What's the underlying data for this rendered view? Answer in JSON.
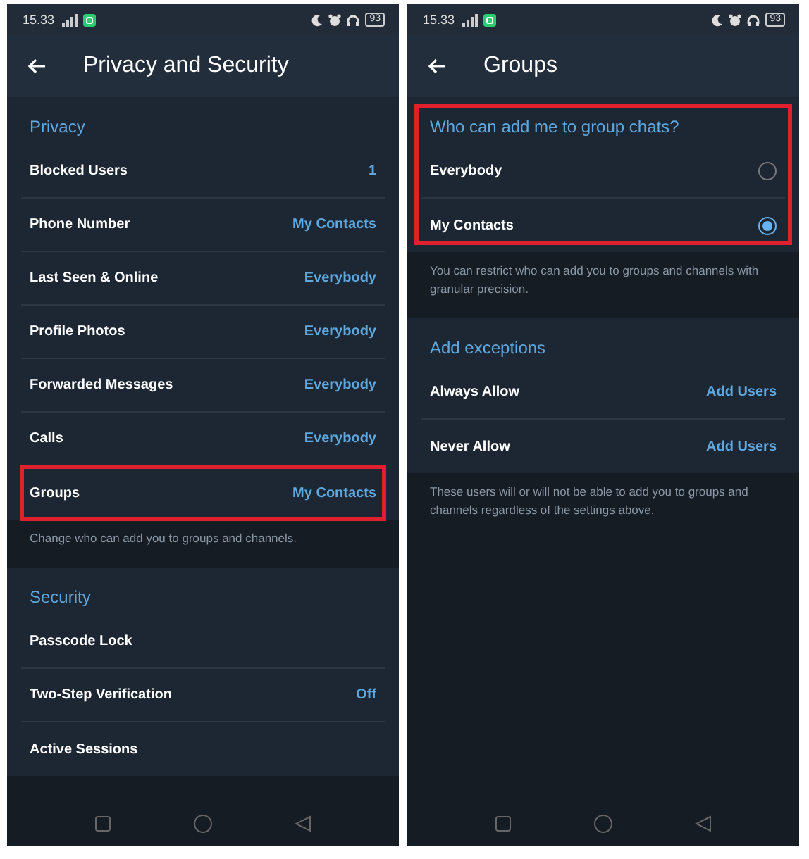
{
  "screens": [
    {
      "status_bar": {
        "time": "15.33",
        "battery": "93"
      },
      "title": "Privacy and Security",
      "sections": [
        {
          "title": "Privacy",
          "highlighted": false,
          "rows": [
            {
              "kind": "value",
              "label": "Blocked Users",
              "value": "1",
              "highlighted": false
            },
            {
              "kind": "value",
              "label": "Phone Number",
              "value": "My Contacts",
              "highlighted": false
            },
            {
              "kind": "value",
              "label": "Last Seen & Online",
              "value": "Everybody",
              "highlighted": false
            },
            {
              "kind": "value",
              "label": "Profile Photos",
              "value": "Everybody",
              "highlighted": false
            },
            {
              "kind": "value",
              "label": "Forwarded Messages",
              "value": "Everybody",
              "highlighted": false
            },
            {
              "kind": "value",
              "label": "Calls",
              "value": "Everybody",
              "highlighted": false
            },
            {
              "kind": "value",
              "label": "Groups",
              "value": "My Contacts",
              "highlighted": true
            }
          ],
          "footer": "Change who can add you to groups and channels."
        },
        {
          "title": "Security",
          "highlighted": false,
          "rows": [
            {
              "kind": "value",
              "label": "Passcode Lock",
              "highlighted": false
            },
            {
              "kind": "value",
              "label": "Two-Step Verification",
              "value": "Off",
              "highlighted": false
            },
            {
              "kind": "value",
              "label": "Active Sessions",
              "highlighted": false
            }
          ]
        }
      ]
    },
    {
      "status_bar": {
        "time": "15.33",
        "battery": "93"
      },
      "title": "Groups",
      "sections": [
        {
          "title": "Who can add me to group chats?",
          "highlighted": true,
          "rows": [
            {
              "kind": "radio",
              "label": "Everybody",
              "selected": false,
              "highlighted": false
            },
            {
              "kind": "radio",
              "label": "My Contacts",
              "selected": true,
              "highlighted": false
            }
          ],
          "footer": "You can restrict who can add you to groups and channels with granular precision."
        },
        {
          "title": "Add exceptions",
          "highlighted": false,
          "rows": [
            {
              "kind": "value",
              "label": "Always Allow",
              "value": "Add Users",
              "highlighted": false
            },
            {
              "kind": "value",
              "label": "Never Allow",
              "value": "Add Users",
              "highlighted": false
            }
          ],
          "footer": "These users will or will not be able to add you to groups and channels regardless of the settings above."
        }
      ]
    }
  ]
}
